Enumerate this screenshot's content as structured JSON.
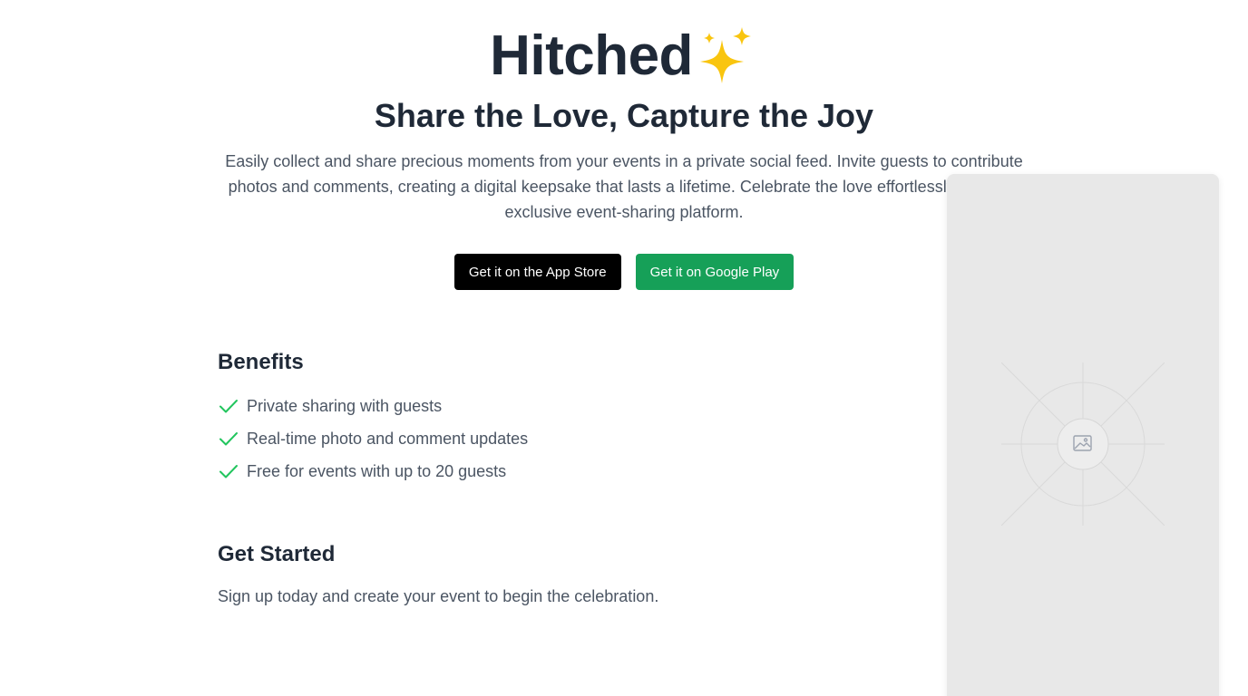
{
  "header": {
    "brand_name": "Hitched",
    "brand_icon": "sparkles-icon",
    "tagline": "Share the Love, Capture the Joy",
    "description": "Easily collect and share precious moments from your events in a private social feed. Invite guests to contribute photos and comments, creating a digital keepsake that lasts a lifetime. Celebrate the love effortlessly, with our exclusive event-sharing platform."
  },
  "cta": {
    "app_store_label": "Get it on the App Store",
    "google_play_label": "Get it on Google Play"
  },
  "benefits": {
    "title": "Benefits",
    "items": [
      {
        "label": "Private sharing with guests",
        "icon": "check-icon"
      },
      {
        "label": "Real-time photo and comment updates",
        "icon": "check-icon"
      },
      {
        "label": "Free for events with up to 20 guests",
        "icon": "check-icon"
      }
    ]
  },
  "get_started": {
    "title": "Get Started",
    "text": "Sign up today and create your event to begin the celebration."
  },
  "preview": {
    "icon": "image-placeholder-icon"
  },
  "colors": {
    "primary_text": "#1f2937",
    "secondary_text": "#4b5563",
    "app_store_button": "#000000",
    "google_play_button": "#16a058",
    "check": "#22c55e",
    "preview_background": "#e8e8e8"
  }
}
